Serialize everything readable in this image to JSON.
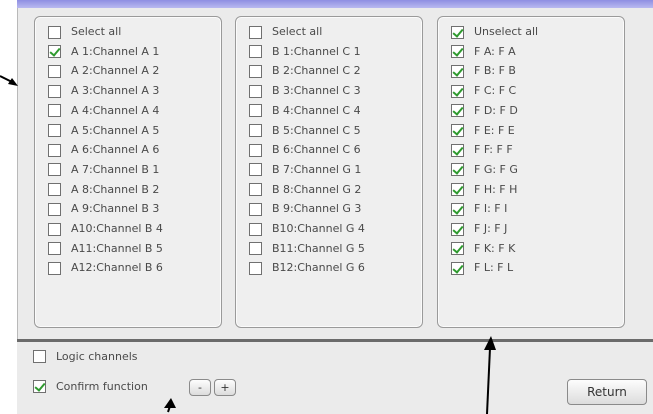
{
  "column_a": {
    "header": {
      "label": "Select all",
      "checked": false
    },
    "items": [
      {
        "label": "A 1:Channel A 1",
        "checked": true
      },
      {
        "label": "A 2:Channel A 2",
        "checked": false
      },
      {
        "label": "A 3:Channel A 3",
        "checked": false
      },
      {
        "label": "A 4:Channel A 4",
        "checked": false
      },
      {
        "label": "A 5:Channel A 5",
        "checked": false
      },
      {
        "label": "A 6:Channel A 6",
        "checked": false
      },
      {
        "label": "A 7:Channel B 1",
        "checked": false
      },
      {
        "label": "A 8:Channel B 2",
        "checked": false
      },
      {
        "label": "A 9:Channel B 3",
        "checked": false
      },
      {
        "label": "A10:Channel B 4",
        "checked": false
      },
      {
        "label": "A11:Channel B 5",
        "checked": false
      },
      {
        "label": "A12:Channel B 6",
        "checked": false
      }
    ]
  },
  "column_b": {
    "header": {
      "label": "Select all",
      "checked": false
    },
    "items": [
      {
        "label": "B 1:Channel C 1",
        "checked": false
      },
      {
        "label": "B 2:Channel C 2",
        "checked": false
      },
      {
        "label": "B 3:Channel C 3",
        "checked": false
      },
      {
        "label": "B 4:Channel C 4",
        "checked": false
      },
      {
        "label": "B 5:Channel C 5",
        "checked": false
      },
      {
        "label": "B 6:Channel C 6",
        "checked": false
      },
      {
        "label": "B 7:Channel G 1",
        "checked": false
      },
      {
        "label": "B 8:Channel G 2",
        "checked": false
      },
      {
        "label": "B 9:Channel G 3",
        "checked": false
      },
      {
        "label": "B10:Channel G 4",
        "checked": false
      },
      {
        "label": "B11:Channel G 5",
        "checked": false
      },
      {
        "label": "B12:Channel G 6",
        "checked": false
      }
    ]
  },
  "column_f": {
    "header": {
      "label": "Unselect all",
      "checked": true
    },
    "items": [
      {
        "label": "F A: F A",
        "checked": true
      },
      {
        "label": "F B: F B",
        "checked": true
      },
      {
        "label": "F C: F C",
        "checked": true
      },
      {
        "label": "F D: F D",
        "checked": true
      },
      {
        "label": "F E: F E",
        "checked": true
      },
      {
        "label": "F F: F F",
        "checked": true
      },
      {
        "label": "F G: F G",
        "checked": true
      },
      {
        "label": "F H: F H",
        "checked": true
      },
      {
        "label": "F I: F I",
        "checked": true
      },
      {
        "label": "F J: F J",
        "checked": true
      },
      {
        "label": "F K: F K",
        "checked": true
      },
      {
        "label": "F L: F L",
        "checked": true
      }
    ]
  },
  "bottom": {
    "logic_channels": {
      "label": "Logic channels",
      "checked": false
    },
    "confirm_function": {
      "label": "Confirm function",
      "checked": true
    },
    "minus_label": "-",
    "plus_label": "+",
    "return_label": "Return"
  },
  "colors": {
    "check": "#2f9a2f",
    "title_bar": "#8e8ee2",
    "background": "#ebebeb"
  }
}
